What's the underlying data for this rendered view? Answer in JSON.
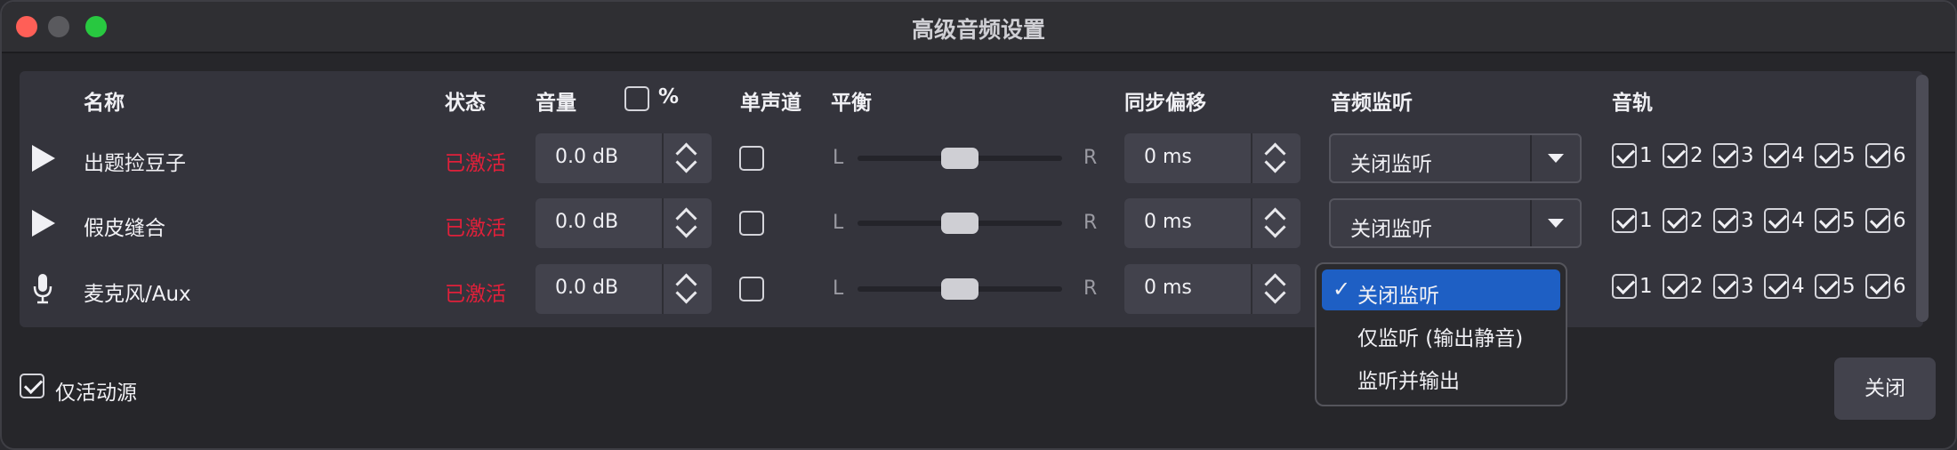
{
  "window": {
    "title": "高级音频设置"
  },
  "columns": {
    "name": "名称",
    "status": "状态",
    "volume": "音量",
    "percent": "%",
    "mono": "单声道",
    "balance": "平衡",
    "sync_offset": "同步偏移",
    "monitoring": "音频监听",
    "tracks": "音轨"
  },
  "balance_labels": {
    "left": "L",
    "right": "R"
  },
  "sources": [
    {
      "name": "出题捡豆子",
      "icon": "play-icon",
      "status": "已激活",
      "volume": "0.0 dB",
      "mono": false,
      "balance": 0.5,
      "sync_offset": "0 ms",
      "monitoring": "关闭监听",
      "tracks": [
        "1",
        "2",
        "3",
        "4",
        "5",
        "6"
      ]
    },
    {
      "name": "假皮缝合",
      "icon": "play-icon",
      "status": "已激活",
      "volume": "0.0 dB",
      "mono": false,
      "balance": 0.5,
      "sync_offset": "0 ms",
      "monitoring": "关闭监听",
      "tracks": [
        "1",
        "2",
        "3",
        "4",
        "5",
        "6"
      ]
    },
    {
      "name": "麦克风/Aux",
      "icon": "microphone-icon",
      "status": "已激活",
      "volume": "0.0 dB",
      "mono": false,
      "balance": 0.5,
      "sync_offset": "0 ms",
      "monitoring": "关闭监听",
      "tracks": [
        "1",
        "2",
        "3",
        "4",
        "5",
        "6"
      ]
    }
  ],
  "monitoring_menu": {
    "options": [
      "关闭监听",
      "仅监听 (输出静音)",
      "监听并输出"
    ],
    "selected": "关闭监听"
  },
  "footer": {
    "active_only_label": "仅活动源",
    "close_label": "关闭"
  },
  "colors": {
    "status_active": "#e0203a",
    "menu_selected": "#1e5fc4"
  }
}
